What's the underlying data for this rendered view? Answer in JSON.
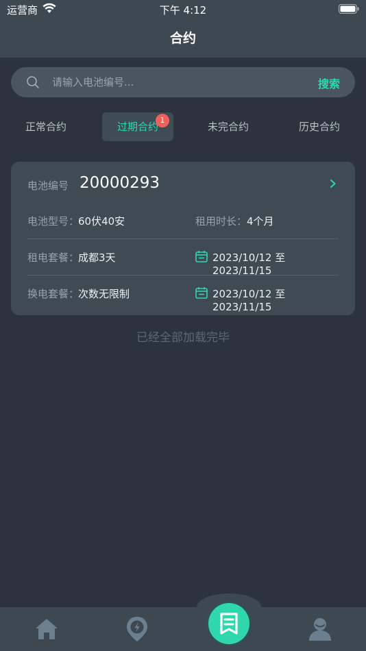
{
  "status_bar": {
    "carrier": "运营商",
    "time": "下午 4:12"
  },
  "nav": {
    "title": "合约"
  },
  "search": {
    "placeholder": "请输入电池编号...",
    "button": "搜索"
  },
  "tabs": [
    {
      "label": "正常合约",
      "active": false
    },
    {
      "label": "过期合约",
      "active": true,
      "badge": "1"
    },
    {
      "label": "未完合约",
      "active": false
    },
    {
      "label": "历史合约",
      "active": false
    }
  ],
  "contract": {
    "battery_no_label": "电池编号",
    "battery_no": "20000293",
    "model_label": "电池型号：",
    "model": "60伏40安",
    "duration_label": "租用时长：",
    "duration": "4个月",
    "rent_plan_label": "租电套餐：",
    "rent_plan": "成都3天",
    "rent_period": "2023/10/12 至 2023/11/15",
    "swap_plan_label": "换电套餐：",
    "swap_plan": "次数无限制",
    "swap_period": "2023/10/12 至 2023/11/15"
  },
  "footer_note": "已经全部加载完毕",
  "tabbar": {
    "items": [
      "home-icon",
      "map-pin-icon",
      "contract-icon",
      "user-icon"
    ],
    "accent": "#2fd8ac"
  }
}
